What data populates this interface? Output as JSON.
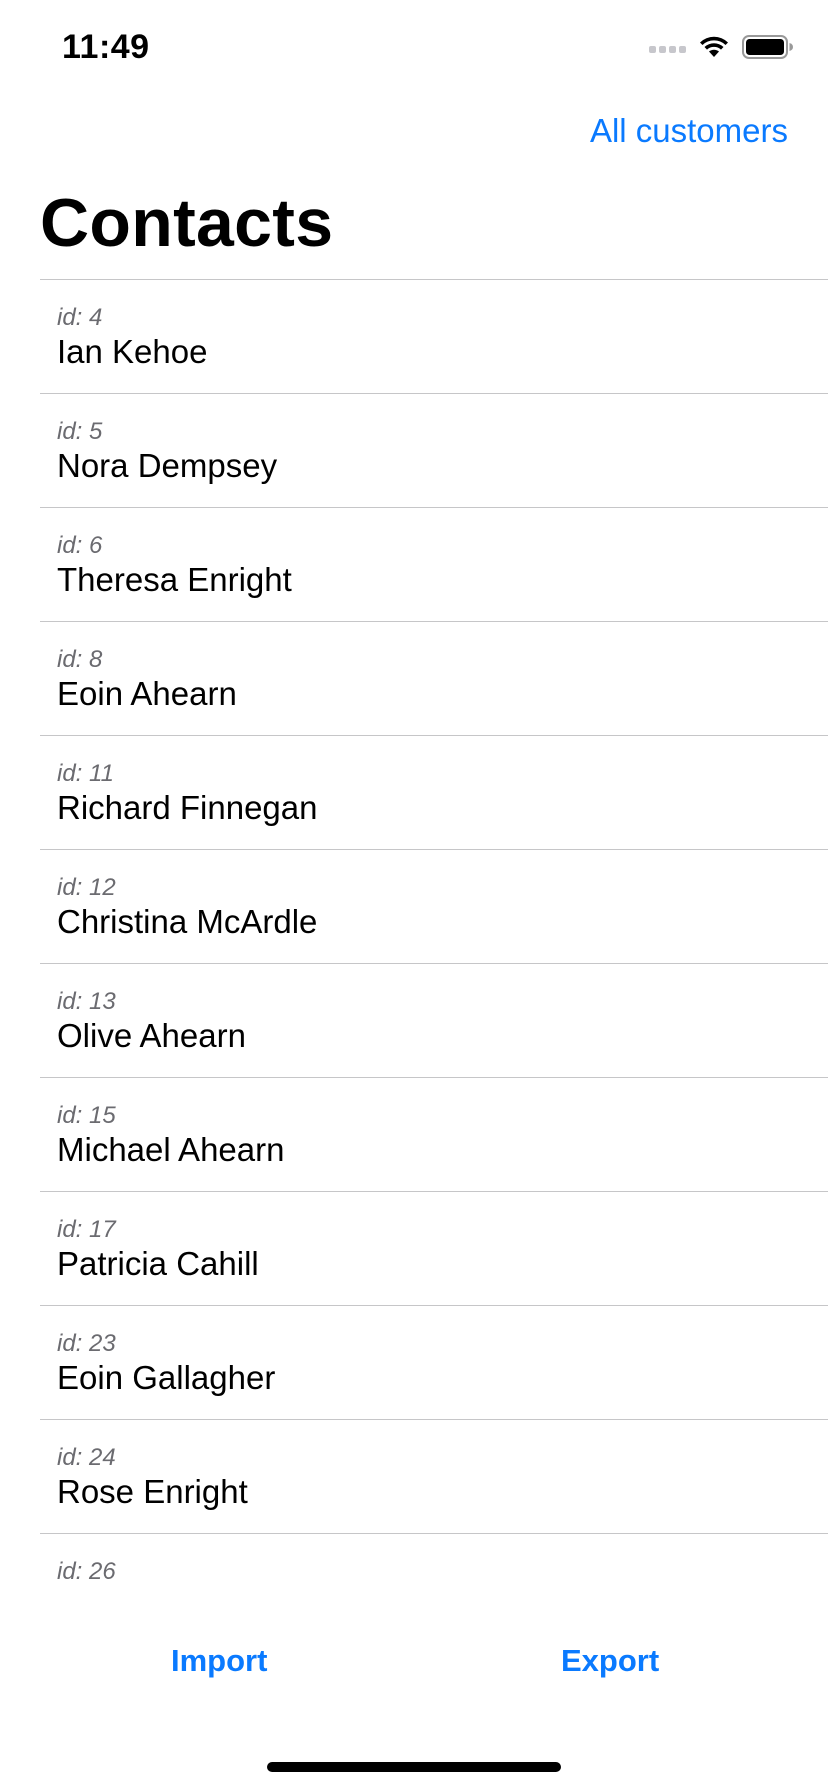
{
  "status_bar": {
    "time": "11:49",
    "icons": [
      "signal-dots-icon",
      "wifi-icon",
      "battery-icon"
    ]
  },
  "nav": {
    "right_button_label": "All customers",
    "title": "Contacts"
  },
  "contacts": [
    {
      "id_label": "id: 4",
      "name": "Ian Kehoe"
    },
    {
      "id_label": "id: 5",
      "name": "Nora Dempsey"
    },
    {
      "id_label": "id: 6",
      "name": "Theresa Enright"
    },
    {
      "id_label": "id: 8",
      "name": "Eoin Ahearn"
    },
    {
      "id_label": "id: 11",
      "name": "Richard Finnegan"
    },
    {
      "id_label": "id: 12",
      "name": "Christina McArdle"
    },
    {
      "id_label": "id: 13",
      "name": "Olive Ahearn"
    },
    {
      "id_label": "id: 15",
      "name": "Michael Ahearn"
    },
    {
      "id_label": "id: 17",
      "name": "Patricia Cahill"
    },
    {
      "id_label": "id: 23",
      "name": "Eoin Gallagher"
    },
    {
      "id_label": "id: 24",
      "name": "Rose Enright"
    },
    {
      "id_label": "id: 26",
      "name": ""
    }
  ],
  "toolbar": {
    "import_label": "Import",
    "export_label": "Export"
  },
  "colors": {
    "accent": "#0a7aff",
    "separator": "#c6c6c8",
    "secondary_text": "#6b6b70"
  }
}
